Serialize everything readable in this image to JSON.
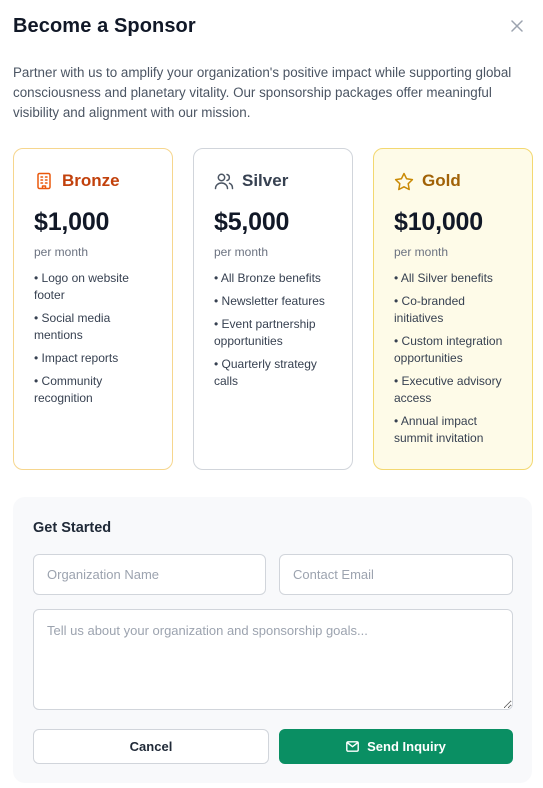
{
  "dialog": {
    "title": "Become a Sponsor",
    "intro": "Partner with us to amplify your organization's positive impact while supporting global consciousness and planetary vitality. Our sponsorship packages offer meaningful visibility and alignment with our mission."
  },
  "tiers": [
    {
      "name": "Bronze",
      "icon": "building-icon",
      "price": "$1,000",
      "period": "per month",
      "benefits": [
        "• Logo on website footer",
        "• Social media mentions",
        "• Impact reports",
        "• Community recognition"
      ]
    },
    {
      "name": "Silver",
      "icon": "users-icon",
      "price": "$5,000",
      "period": "per month",
      "benefits": [
        "• All Bronze benefits",
        "• Newsletter features",
        "• Event partnership opportunities",
        "• Quarterly strategy calls"
      ]
    },
    {
      "name": "Gold",
      "icon": "star-icon",
      "price": "$10,000",
      "period": "per month",
      "benefits": [
        "• All Silver benefits",
        "• Co-branded initiatives",
        "• Custom integration opportunities",
        "• Executive advisory access",
        "• Annual impact summit invitation"
      ]
    }
  ],
  "form": {
    "title": "Get Started",
    "org_placeholder": "Organization Name",
    "email_placeholder": "Contact Email",
    "message_placeholder": "Tell us about your organization and sponsorship goals...",
    "cancel_label": "Cancel",
    "send_label": "Send Inquiry"
  },
  "colors": {
    "bronze": "#c2410c",
    "silver": "#374151",
    "gold": "#a16207",
    "send_button": "#0a8f63"
  }
}
